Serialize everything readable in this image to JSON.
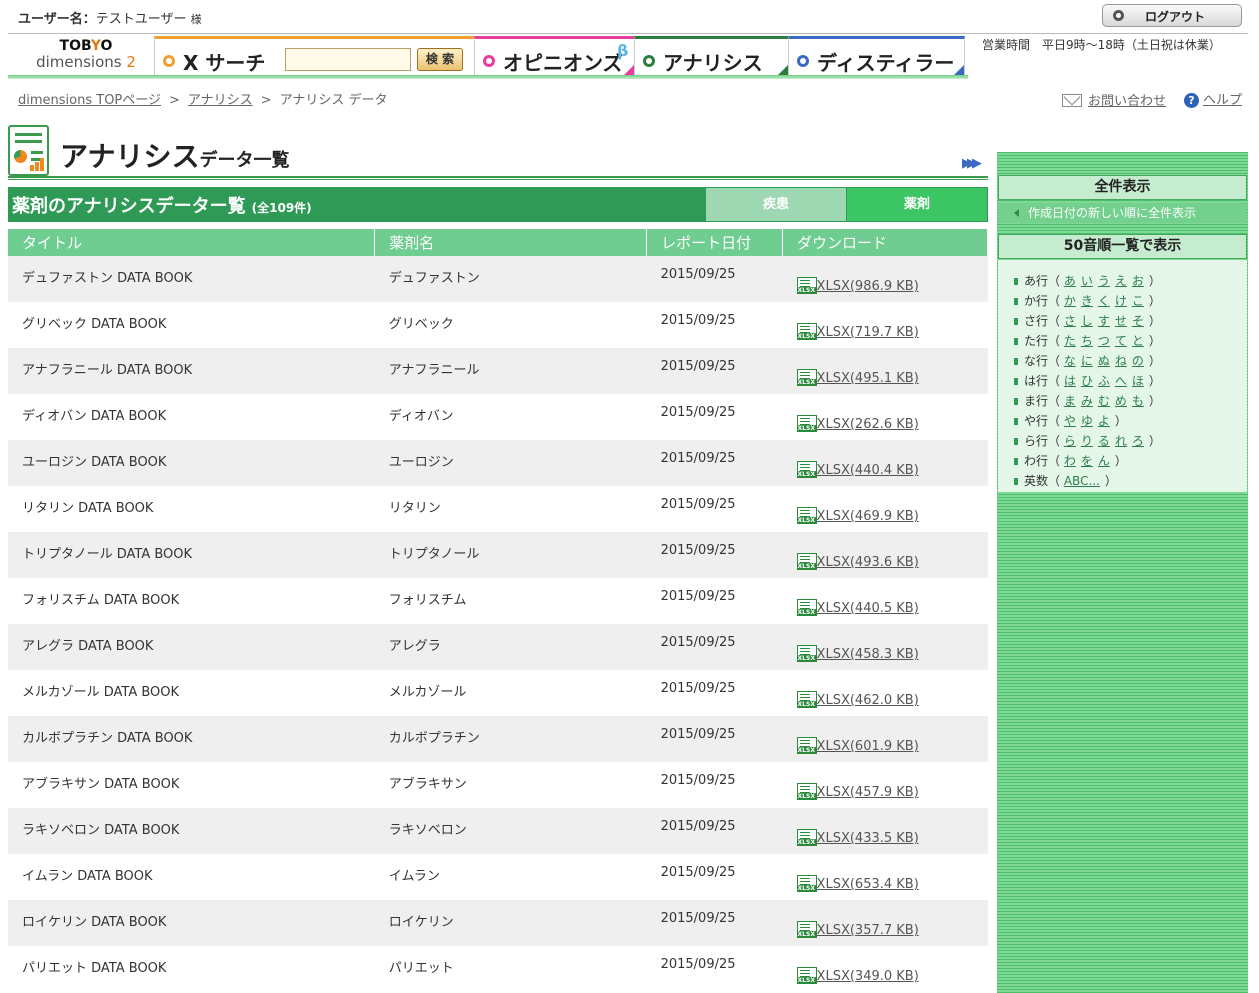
{
  "header": {
    "user_label": "ユーザー名：",
    "user_name": "テストユーザー",
    "honorific": "様",
    "logout": "ログアウト",
    "hours": "営業時間　平日9時～18時（土日祝は休業）"
  },
  "logo": {
    "line1_a": "TOB",
    "line1_o": "Y",
    "line1_b": "O",
    "line2": "dimensions",
    "line2_num": "2"
  },
  "nav": {
    "xsearch": "X サーチ",
    "search_value": "",
    "search_button": "検 索",
    "opinions": "オピニオンズ",
    "beta": "β",
    "analysis": "アナリシス",
    "distiller": "ディスティラー"
  },
  "breadcrumb": {
    "home": "dimensions TOPページ",
    "analysis": "アナリシス",
    "current": "アナリシス データ",
    "sep": ">"
  },
  "utility": {
    "contact": "お問い合わせ",
    "help": "ヘルプ",
    "help_icon": "?"
  },
  "page": {
    "title": "アナリシス",
    "title_sub": "データ一覧",
    "more_icon": "▶▶▶"
  },
  "list": {
    "heading": "薬剤のアナリシスデーター覧",
    "count": "(全109件)",
    "tab_disease": "疾患",
    "tab_drug": "薬剤",
    "columns": [
      "タイトル",
      "薬剤名",
      "レポート日付",
      "ダウンロード"
    ],
    "rows": [
      {
        "title": "デュファストン DATA BOOK",
        "drug": "デュファストン",
        "date": "2015/09/25",
        "file": "XLSX(986.9 KB)"
      },
      {
        "title": "グリベック DATA BOOK",
        "drug": "グリベック",
        "date": "2015/09/25",
        "file": "XLSX(719.7 KB)"
      },
      {
        "title": "アナフラニール DATA BOOK",
        "drug": "アナフラニール",
        "date": "2015/09/25",
        "file": "XLSX(495.1 KB)"
      },
      {
        "title": "ディオバン DATA BOOK",
        "drug": "ディオバン",
        "date": "2015/09/25",
        "file": "XLSX(262.6 KB)"
      },
      {
        "title": "ユーロジン DATA BOOK",
        "drug": "ユーロジン",
        "date": "2015/09/25",
        "file": "XLSX(440.4 KB)"
      },
      {
        "title": "リタリン DATA BOOK",
        "drug": "リタリン",
        "date": "2015/09/25",
        "file": "XLSX(469.9 KB)"
      },
      {
        "title": "トリプタノール DATA BOOK",
        "drug": "トリプタノール",
        "date": "2015/09/25",
        "file": "XLSX(493.6 KB)"
      },
      {
        "title": "フォリスチム DATA BOOK",
        "drug": "フォリスチム",
        "date": "2015/09/25",
        "file": "XLSX(440.5 KB)"
      },
      {
        "title": "アレグラ DATA BOOK",
        "drug": "アレグラ",
        "date": "2015/09/25",
        "file": "XLSX(458.3 KB)"
      },
      {
        "title": "メルカゾール DATA BOOK",
        "drug": "メルカゾール",
        "date": "2015/09/25",
        "file": "XLSX(462.0 KB)"
      },
      {
        "title": "カルボプラチン DATA BOOK",
        "drug": "カルボプラチン",
        "date": "2015/09/25",
        "file": "XLSX(601.9 KB)"
      },
      {
        "title": "アブラキサン DATA BOOK",
        "drug": "アブラキサン",
        "date": "2015/09/25",
        "file": "XLSX(457.9 KB)"
      },
      {
        "title": "ラキソベロン DATA BOOK",
        "drug": "ラキソベロン",
        "date": "2015/09/25",
        "file": "XLSX(433.5 KB)"
      },
      {
        "title": "イムラン DATA BOOK",
        "drug": "イムラン",
        "date": "2015/09/25",
        "file": "XLSX(653.4 KB)"
      },
      {
        "title": "ロイケリン DATA BOOK",
        "drug": "ロイケリン",
        "date": "2015/09/25",
        "file": "XLSX(357.7 KB)"
      },
      {
        "title": "パリエット DATA BOOK",
        "drug": "パリエット",
        "date": "2015/09/25",
        "file": "XLSX(349.0 KB)"
      }
    ]
  },
  "sidebar": {
    "all_heading": "全件表示",
    "all_link": "作成日付の新しい順に全件表示",
    "kana_heading": "50音順一覧で表示",
    "kana_rows": [
      {
        "label": "あ行",
        "chars": [
          "あ",
          "い",
          "う",
          "え",
          "お"
        ]
      },
      {
        "label": "か行",
        "chars": [
          "か",
          "き",
          "く",
          "け",
          "こ"
        ]
      },
      {
        "label": "さ行",
        "chars": [
          "さ",
          "し",
          "す",
          "せ",
          "そ"
        ]
      },
      {
        "label": "た行",
        "chars": [
          "た",
          "ち",
          "つ",
          "て",
          "と"
        ]
      },
      {
        "label": "な行",
        "chars": [
          "な",
          "に",
          "ぬ",
          "ね",
          "の"
        ]
      },
      {
        "label": "は行",
        "chars": [
          "は",
          "ひ",
          "ふ",
          "へ",
          "ほ"
        ]
      },
      {
        "label": "ま行",
        "chars": [
          "ま",
          "み",
          "む",
          "め",
          "も"
        ]
      },
      {
        "label": "や行",
        "chars": [
          "や",
          "ゆ",
          "よ"
        ]
      },
      {
        "label": "ら行",
        "chars": [
          "ら",
          "り",
          "る",
          "れ",
          "ろ"
        ]
      },
      {
        "label": "わ行",
        "chars": [
          "わ",
          "を",
          "ん"
        ]
      },
      {
        "label": "英数",
        "chars": [
          "ABC..."
        ]
      }
    ]
  }
}
